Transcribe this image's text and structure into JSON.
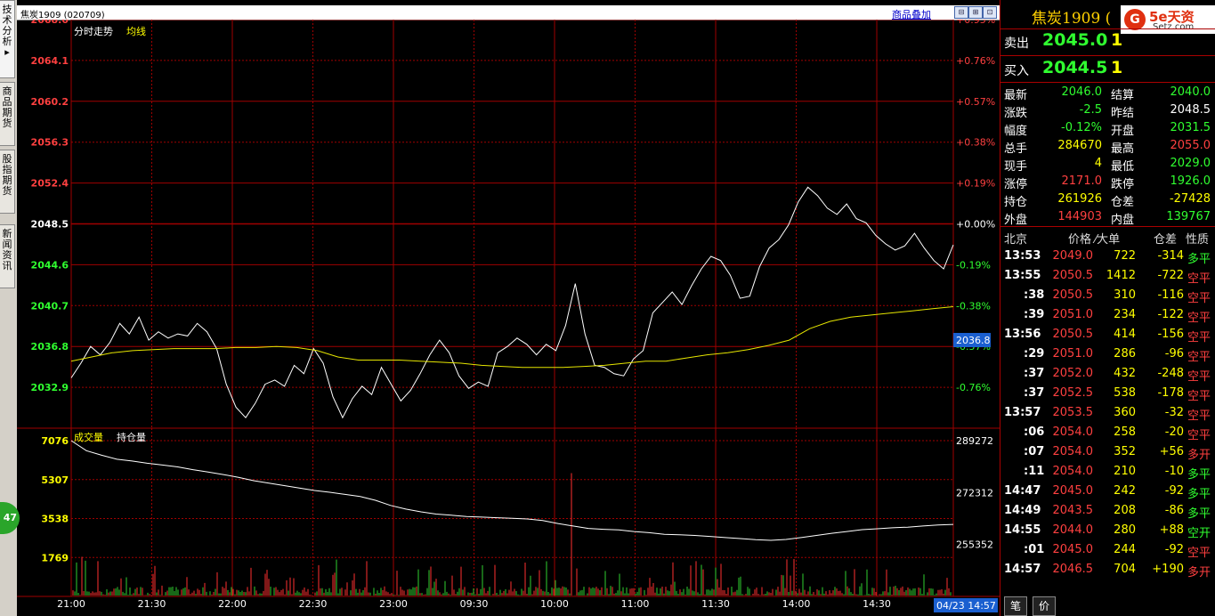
{
  "sidebar": {
    "tabs": [
      {
        "label": "技术分析▸"
      },
      {
        "label": "商品期货"
      },
      {
        "label": "股指期货"
      },
      {
        "label": "新闻资讯"
      }
    ],
    "float_badge": "47"
  },
  "header": {
    "title": "焦炭1909 (020709)",
    "overlay_link": "商品叠加"
  },
  "chart": {
    "legend_intraday": "分时走势",
    "legend_avg": "均线",
    "legend_volume": "成交量",
    "legend_oi": "持仓量",
    "current_price_tag": "2036.8",
    "current_time_tag": "04/23 14:57"
  },
  "chart_data": [
    {
      "type": "line",
      "name": "price",
      "y_ticks": [
        "2068.0",
        "2064.1",
        "2060.2",
        "2056.3",
        "2052.4",
        "2048.5",
        "2044.6",
        "2040.7",
        "2036.8",
        "2032.9"
      ],
      "pct_ticks": [
        "+0.95%",
        "+0.76%",
        "+0.57%",
        "+0.38%",
        "+0.19%",
        "+0.00%",
        "-0.19%",
        "-0.38%",
        "-0.57%",
        "-0.76%"
      ],
      "ylim": [
        2029.0,
        2068.0
      ],
      "prev_settle": 2048.5,
      "x_ticks": [
        "21:00",
        "21:30",
        "22:00",
        "22:30",
        "23:00",
        "09:30",
        "10:00",
        "11:00",
        "11:30",
        "14:00",
        "14:30"
      ],
      "price_points": [
        2033.8,
        2035.2,
        2036.8,
        2036.0,
        2037.2,
        2039.0,
        2038.0,
        2039.6,
        2037.4,
        2038.2,
        2037.6,
        2038.0,
        2037.8,
        2039.0,
        2038.2,
        2036.6,
        2033.2,
        2031.0,
        2030.0,
        2031.4,
        2033.2,
        2033.6,
        2033.0,
        2035.0,
        2034.2,
        2036.6,
        2035.2,
        2032.0,
        2030.0,
        2031.8,
        2033.0,
        2032.2,
        2034.8,
        2033.2,
        2031.6,
        2032.6,
        2034.2,
        2036.0,
        2037.4,
        2036.2,
        2034.0,
        2032.8,
        2033.4,
        2033.0,
        2036.2,
        2036.8,
        2037.6,
        2037.0,
        2036.0,
        2037.0,
        2036.4,
        2038.8,
        2042.8,
        2038.0,
        2035.0,
        2034.8,
        2034.2,
        2034.0,
        2035.6,
        2036.4,
        2040.0,
        2041.0,
        2042.0,
        2040.8,
        2042.6,
        2044.2,
        2045.4,
        2045.0,
        2043.6,
        2041.4,
        2041.6,
        2044.4,
        2046.2,
        2047.0,
        2048.4,
        2050.6,
        2052.0,
        2051.2,
        2050.0,
        2049.4,
        2050.4,
        2049.0,
        2048.6,
        2047.4,
        2046.6,
        2046.0,
        2046.4,
        2047.6,
        2046.2,
        2045.0,
        2044.2,
        2046.5
      ],
      "avg_points": [
        2035.4,
        2035.8,
        2036.2,
        2036.4,
        2036.5,
        2036.6,
        2036.6,
        2036.6,
        2036.7,
        2036.7,
        2036.8,
        2036.7,
        2036.4,
        2035.8,
        2035.5,
        2035.5,
        2035.5,
        2035.4,
        2035.3,
        2035.2,
        2035.0,
        2034.9,
        2034.8,
        2034.8,
        2034.8,
        2034.9,
        2035.0,
        2035.2,
        2035.4,
        2035.4,
        2035.7,
        2036.0,
        2036.2,
        2036.5,
        2036.9,
        2037.4,
        2038.5,
        2039.2,
        2039.6,
        2039.8,
        2040.0,
        2040.2,
        2040.4,
        2040.6
      ],
      "title": "分时走势"
    },
    {
      "type": "bar",
      "name": "volume",
      "y_ticks_left": [
        "7076",
        "5307",
        "3538",
        "1769"
      ],
      "y_ticks_right": [
        "289272",
        "272312",
        "255352"
      ],
      "ylim": [
        0,
        7076
      ],
      "oi_ylim": [
        238392,
        289272
      ],
      "oi_points": [
        289272,
        286000,
        284500,
        283200,
        282600,
        281900,
        281300,
        280700,
        279800,
        279000,
        278200,
        277300,
        276200,
        275400,
        274600,
        273800,
        273000,
        272400,
        271700,
        271000,
        269800,
        268100,
        266900,
        266000,
        265300,
        264900,
        264500,
        264300,
        264100,
        263900,
        263700,
        263200,
        262200,
        261400,
        260600,
        260300,
        260100,
        259600,
        259200,
        258700,
        258500,
        258300,
        258000,
        257600,
        257300,
        256900,
        256700,
        257000,
        257600,
        258300,
        259000,
        259600,
        260200,
        260500,
        260800,
        261000,
        261400,
        261700,
        261926
      ],
      "title": "成交量"
    }
  ],
  "quote": {
    "title": "焦炭1909 (",
    "logo_text": "5e天资",
    "logo_sub": "Setz.com",
    "logo_icon": "G",
    "sell_label": "卖出",
    "sell_price": "2045.0",
    "sell_vol": "1",
    "buy_label": "买入",
    "buy_price": "2044.5",
    "buy_vol": "1",
    "stats": [
      {
        "l1": "最新",
        "v1": "2046.0",
        "c1": "#30ff30",
        "l2": "结算",
        "v2": "2040.0",
        "c2": "#30ff30"
      },
      {
        "l1": "涨跌",
        "v1": "-2.5",
        "c1": "#30ff30",
        "l2": "昨结",
        "v2": "2048.5",
        "c2": "#ffffff"
      },
      {
        "l1": "幅度",
        "v1": "-0.12%",
        "c1": "#30ff30",
        "l2": "开盘",
        "v2": "2031.5",
        "c2": "#30ff30"
      },
      {
        "l1": "总手",
        "v1": "284670",
        "c1": "#ffff00",
        "l2": "最高",
        "v2": "2055.0",
        "c2": "#ff4040"
      },
      {
        "l1": "现手",
        "v1": "4",
        "c1": "#ffff00",
        "l2": "最低",
        "v2": "2029.0",
        "c2": "#30ff30"
      },
      {
        "l1": "涨停",
        "v1": "2171.0",
        "c1": "#ff4040",
        "l2": "跌停",
        "v2": "1926.0",
        "c2": "#30ff30"
      },
      {
        "l1": "持仓",
        "v1": "261926",
        "c1": "#ffff00",
        "l2": "仓差",
        "v2": "-27428",
        "c2": "#ffff00"
      },
      {
        "l1": "外盘",
        "v1": "144903",
        "c1": "#ff4040",
        "l2": "内盘",
        "v2": "139767",
        "c2": "#30ff30"
      }
    ],
    "tick_headers": {
      "time": "北京",
      "price": "价格",
      "vol": "⁄大单",
      "oi": "仓差",
      "nature": "性质"
    },
    "ticks": [
      {
        "t": "13:53",
        "p": "2049.0",
        "v": "722",
        "d": "-314",
        "n": "多平",
        "nc": "#30ff30"
      },
      {
        "t": "13:55",
        "p": "2050.5",
        "v": "1412",
        "d": "-722",
        "n": "空平",
        "nc": "#ff4040"
      },
      {
        "t": ":38",
        "p": "2050.5",
        "v": "310",
        "d": "-116",
        "n": "空平",
        "nc": "#ff4040"
      },
      {
        "t": ":39",
        "p": "2051.0",
        "v": "234",
        "d": "-122",
        "n": "空平",
        "nc": "#ff4040"
      },
      {
        "t": "13:56",
        "p": "2050.5",
        "v": "414",
        "d": "-156",
        "n": "空平",
        "nc": "#ff4040"
      },
      {
        "t": ":29",
        "p": "2051.0",
        "v": "286",
        "d": "-96",
        "n": "空平",
        "nc": "#ff4040"
      },
      {
        "t": ":37",
        "p": "2052.0",
        "v": "432",
        "d": "-248",
        "n": "空平",
        "nc": "#ff4040"
      },
      {
        "t": ":37",
        "p": "2052.5",
        "v": "538",
        "d": "-178",
        "n": "空平",
        "nc": "#ff4040"
      },
      {
        "t": "13:57",
        "p": "2053.5",
        "v": "360",
        "d": "-32",
        "n": "空平",
        "nc": "#ff4040"
      },
      {
        "t": ":06",
        "p": "2054.0",
        "v": "258",
        "d": "-20",
        "n": "空平",
        "nc": "#ff4040"
      },
      {
        "t": ":07",
        "p": "2054.0",
        "v": "352",
        "d": "+56",
        "n": "多开",
        "nc": "#ff4040"
      },
      {
        "t": ":11",
        "p": "2054.0",
        "v": "210",
        "d": "-10",
        "n": "多平",
        "nc": "#30ff30"
      },
      {
        "t": "14:47",
        "p": "2045.0",
        "v": "242",
        "d": "-92",
        "n": "多平",
        "nc": "#30ff30"
      },
      {
        "t": "14:49",
        "p": "2043.5",
        "v": "208",
        "d": "-86",
        "n": "多平",
        "nc": "#30ff30"
      },
      {
        "t": "14:55",
        "p": "2044.0",
        "v": "280",
        "d": "+88",
        "n": "空开",
        "nc": "#30ff30"
      },
      {
        "t": ":01",
        "p": "2045.0",
        "v": "244",
        "d": "-92",
        "n": "空平",
        "nc": "#ff4040"
      },
      {
        "t": "14:57",
        "p": "2046.5",
        "v": "704",
        "d": "+190",
        "n": "多开",
        "nc": "#ff4040"
      }
    ],
    "tab_trades": "笔",
    "tab_price": "价"
  }
}
